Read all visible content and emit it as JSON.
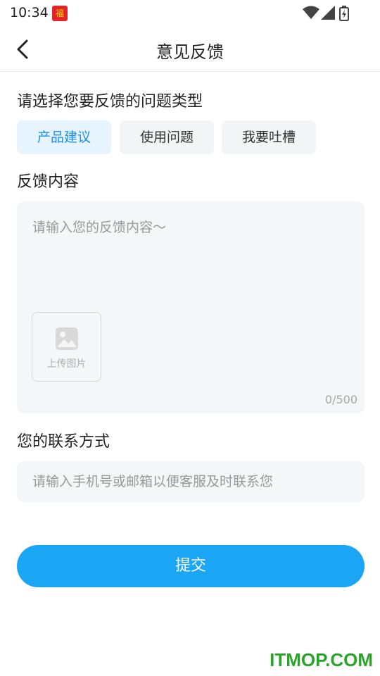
{
  "status_bar": {
    "time": "10:34",
    "app_icon": "red-envelope-app-icon",
    "icons": [
      "wifi-icon",
      "signal-icon",
      "battery-charging-icon"
    ]
  },
  "nav": {
    "back_icon": "chevron-left-icon",
    "title": "意见反馈"
  },
  "feedback_type": {
    "label": "请选择您要反馈的问题类型",
    "options": [
      {
        "label": "产品建议",
        "selected": true
      },
      {
        "label": "使用问题",
        "selected": false
      },
      {
        "label": "我要吐槽",
        "selected": false
      }
    ]
  },
  "feedback_content": {
    "label": "反馈内容",
    "placeholder": "请输入您的反馈内容～",
    "upload_label": "上传图片",
    "upload_icon": "image-icon",
    "char_count": "0/500"
  },
  "contact": {
    "label": "您的联系方式",
    "placeholder": "请输入手机号或邮箱以便客服及时联系您",
    "value": ""
  },
  "submit": {
    "label": "提交"
  },
  "watermark": "ITMOP.COM",
  "colors": {
    "accent": "#1aa5f5",
    "selected_chip_bg": "#e7f3fd",
    "selected_chip_text": "#1a8ff0",
    "field_bg": "#f5f6f8",
    "watermark": "#2aa52a"
  }
}
